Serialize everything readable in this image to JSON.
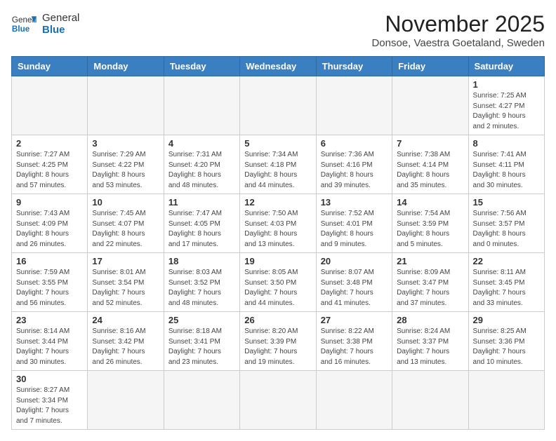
{
  "logo": {
    "general": "General",
    "blue": "Blue"
  },
  "title": "November 2025",
  "location": "Donsoe, Vaestra Goetaland, Sweden",
  "headers": [
    "Sunday",
    "Monday",
    "Tuesday",
    "Wednesday",
    "Thursday",
    "Friday",
    "Saturday"
  ],
  "weeks": [
    [
      {
        "day": "",
        "info": ""
      },
      {
        "day": "",
        "info": ""
      },
      {
        "day": "",
        "info": ""
      },
      {
        "day": "",
        "info": ""
      },
      {
        "day": "",
        "info": ""
      },
      {
        "day": "",
        "info": ""
      },
      {
        "day": "1",
        "info": "Sunrise: 7:25 AM\nSunset: 4:27 PM\nDaylight: 9 hours\nand 2 minutes."
      }
    ],
    [
      {
        "day": "2",
        "info": "Sunrise: 7:27 AM\nSunset: 4:25 PM\nDaylight: 8 hours\nand 57 minutes."
      },
      {
        "day": "3",
        "info": "Sunrise: 7:29 AM\nSunset: 4:22 PM\nDaylight: 8 hours\nand 53 minutes."
      },
      {
        "day": "4",
        "info": "Sunrise: 7:31 AM\nSunset: 4:20 PM\nDaylight: 8 hours\nand 48 minutes."
      },
      {
        "day": "5",
        "info": "Sunrise: 7:34 AM\nSunset: 4:18 PM\nDaylight: 8 hours\nand 44 minutes."
      },
      {
        "day": "6",
        "info": "Sunrise: 7:36 AM\nSunset: 4:16 PM\nDaylight: 8 hours\nand 39 minutes."
      },
      {
        "day": "7",
        "info": "Sunrise: 7:38 AM\nSunset: 4:14 PM\nDaylight: 8 hours\nand 35 minutes."
      },
      {
        "day": "8",
        "info": "Sunrise: 7:41 AM\nSunset: 4:11 PM\nDaylight: 8 hours\nand 30 minutes."
      }
    ],
    [
      {
        "day": "9",
        "info": "Sunrise: 7:43 AM\nSunset: 4:09 PM\nDaylight: 8 hours\nand 26 minutes."
      },
      {
        "day": "10",
        "info": "Sunrise: 7:45 AM\nSunset: 4:07 PM\nDaylight: 8 hours\nand 22 minutes."
      },
      {
        "day": "11",
        "info": "Sunrise: 7:47 AM\nSunset: 4:05 PM\nDaylight: 8 hours\nand 17 minutes."
      },
      {
        "day": "12",
        "info": "Sunrise: 7:50 AM\nSunset: 4:03 PM\nDaylight: 8 hours\nand 13 minutes."
      },
      {
        "day": "13",
        "info": "Sunrise: 7:52 AM\nSunset: 4:01 PM\nDaylight: 8 hours\nand 9 minutes."
      },
      {
        "day": "14",
        "info": "Sunrise: 7:54 AM\nSunset: 3:59 PM\nDaylight: 8 hours\nand 5 minutes."
      },
      {
        "day": "15",
        "info": "Sunrise: 7:56 AM\nSunset: 3:57 PM\nDaylight: 8 hours\nand 0 minutes."
      }
    ],
    [
      {
        "day": "16",
        "info": "Sunrise: 7:59 AM\nSunset: 3:55 PM\nDaylight: 7 hours\nand 56 minutes."
      },
      {
        "day": "17",
        "info": "Sunrise: 8:01 AM\nSunset: 3:54 PM\nDaylight: 7 hours\nand 52 minutes."
      },
      {
        "day": "18",
        "info": "Sunrise: 8:03 AM\nSunset: 3:52 PM\nDaylight: 7 hours\nand 48 minutes."
      },
      {
        "day": "19",
        "info": "Sunrise: 8:05 AM\nSunset: 3:50 PM\nDaylight: 7 hours\nand 44 minutes."
      },
      {
        "day": "20",
        "info": "Sunrise: 8:07 AM\nSunset: 3:48 PM\nDaylight: 7 hours\nand 41 minutes."
      },
      {
        "day": "21",
        "info": "Sunrise: 8:09 AM\nSunset: 3:47 PM\nDaylight: 7 hours\nand 37 minutes."
      },
      {
        "day": "22",
        "info": "Sunrise: 8:11 AM\nSunset: 3:45 PM\nDaylight: 7 hours\nand 33 minutes."
      }
    ],
    [
      {
        "day": "23",
        "info": "Sunrise: 8:14 AM\nSunset: 3:44 PM\nDaylight: 7 hours\nand 30 minutes."
      },
      {
        "day": "24",
        "info": "Sunrise: 8:16 AM\nSunset: 3:42 PM\nDaylight: 7 hours\nand 26 minutes."
      },
      {
        "day": "25",
        "info": "Sunrise: 8:18 AM\nSunset: 3:41 PM\nDaylight: 7 hours\nand 23 minutes."
      },
      {
        "day": "26",
        "info": "Sunrise: 8:20 AM\nSunset: 3:39 PM\nDaylight: 7 hours\nand 19 minutes."
      },
      {
        "day": "27",
        "info": "Sunrise: 8:22 AM\nSunset: 3:38 PM\nDaylight: 7 hours\nand 16 minutes."
      },
      {
        "day": "28",
        "info": "Sunrise: 8:24 AM\nSunset: 3:37 PM\nDaylight: 7 hours\nand 13 minutes."
      },
      {
        "day": "29",
        "info": "Sunrise: 8:25 AM\nSunset: 3:36 PM\nDaylight: 7 hours\nand 10 minutes."
      }
    ],
    [
      {
        "day": "30",
        "info": "Sunrise: 8:27 AM\nSunset: 3:34 PM\nDaylight: 7 hours\nand 7 minutes."
      },
      {
        "day": "",
        "info": ""
      },
      {
        "day": "",
        "info": ""
      },
      {
        "day": "",
        "info": ""
      },
      {
        "day": "",
        "info": ""
      },
      {
        "day": "",
        "info": ""
      },
      {
        "day": "",
        "info": ""
      }
    ]
  ]
}
